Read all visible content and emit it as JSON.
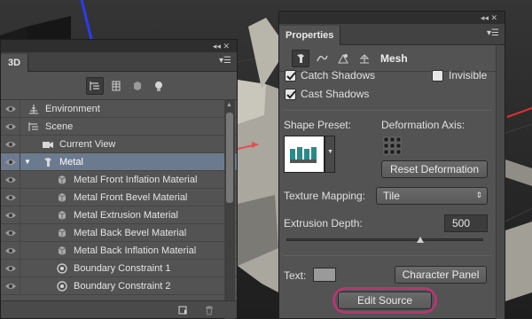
{
  "panel3d": {
    "tab_label": "3D",
    "window_controls": "◂◂ ✕",
    "rows": [
      {
        "label": "Environment",
        "indent": 0,
        "icon": "environment-icon",
        "expander": ""
      },
      {
        "label": "Scene",
        "indent": 0,
        "icon": "scene-icon",
        "expander": ""
      },
      {
        "label": "Current View",
        "indent": 1,
        "icon": "camera-icon",
        "expander": ""
      },
      {
        "label": "Metal",
        "indent": 1,
        "icon": "mesh-icon",
        "expander": "▼",
        "selected": true
      },
      {
        "label": "Metal Front Inflation Material",
        "indent": 2,
        "icon": "material-icon",
        "expander": ""
      },
      {
        "label": "Metal Front Bevel Material",
        "indent": 2,
        "icon": "material-icon",
        "expander": ""
      },
      {
        "label": "Metal Extrusion Material",
        "indent": 2,
        "icon": "material-icon",
        "expander": ""
      },
      {
        "label": "Metal Back Bevel Material",
        "indent": 2,
        "icon": "material-icon",
        "expander": ""
      },
      {
        "label": "Metal Back Inflation Material",
        "indent": 2,
        "icon": "material-icon",
        "expander": ""
      },
      {
        "label": "Boundary Constraint 1",
        "indent": 2,
        "icon": "constraint-icon",
        "expander": ""
      },
      {
        "label": "Boundary Constraint 2",
        "indent": 2,
        "icon": "constraint-icon",
        "expander": ""
      }
    ]
  },
  "props": {
    "tab_label": "Properties",
    "window_controls": "◂◂ ✕",
    "mode_title": "Mesh",
    "catch_shadows": {
      "label": "Catch Shadows",
      "checked": true
    },
    "invisible": {
      "label": "Invisible",
      "checked": false
    },
    "cast_shadows": {
      "label": "Cast Shadows",
      "checked": true
    },
    "shape_preset_label": "Shape Preset:",
    "deformation_axis_label": "Deformation Axis:",
    "reset_deformation": "Reset Deformation",
    "texture_mapping_label": "Texture Mapping:",
    "texture_mapping_value": "Tile",
    "extrusion_depth_label": "Extrusion Depth:",
    "extrusion_depth_value": "500",
    "extrusion_slider_fraction": 0.68,
    "text_label": "Text:",
    "character_panel": "Character Panel",
    "edit_source": "Edit Source"
  },
  "colors": {
    "panel_bg": "#535353",
    "selection": "#6b7a8f",
    "highlight_ring": "#b33873",
    "axis_red": "#e03030",
    "axis_blue": "#2a3cf0"
  }
}
